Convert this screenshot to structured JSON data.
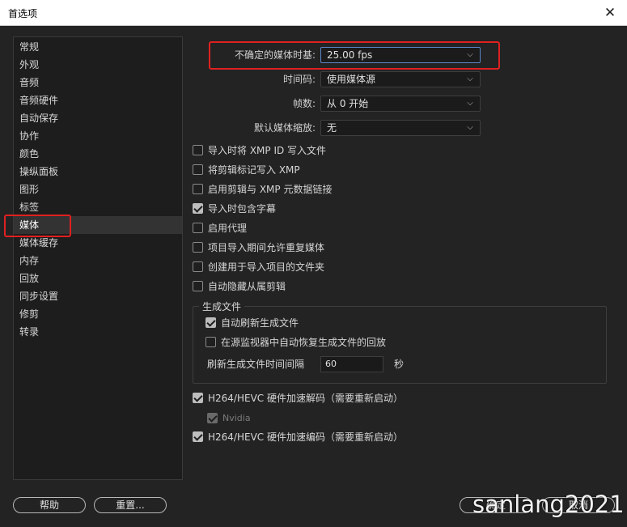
{
  "window": {
    "title": "首选项",
    "close_glyph": "✕"
  },
  "sidebar": {
    "items": [
      "常规",
      "外观",
      "音频",
      "音频硬件",
      "自动保存",
      "协作",
      "颜色",
      "操纵面板",
      "图形",
      "标签",
      "媒体",
      "媒体缓存",
      "内存",
      "回放",
      "同步设置",
      "修剪",
      "转录"
    ],
    "selected_index": 10
  },
  "media": {
    "fps": {
      "label": "不确定的媒体时基:",
      "value": "25.00 fps"
    },
    "timecode": {
      "label": "时间码:",
      "value": "使用媒体源"
    },
    "frame_number": {
      "label": "帧数:",
      "value": "从 0 开始"
    },
    "default_scaling": {
      "label": "默认媒体缩放:",
      "value": "无"
    },
    "checkboxes": [
      {
        "label": "导入时将 XMP ID 写入文件",
        "checked": false
      },
      {
        "label": "将剪辑标记写入 XMP",
        "checked": false
      },
      {
        "label": "启用剪辑与 XMP 元数据链接",
        "checked": false
      },
      {
        "label": "导入时包含字幕",
        "checked": true
      },
      {
        "label": "启用代理",
        "checked": false
      },
      {
        "label": "项目导入期间允许重复媒体",
        "checked": false
      },
      {
        "label": "创建用于导入项目的文件夹",
        "checked": false
      },
      {
        "label": "自动隐藏从属剪辑",
        "checked": false
      }
    ],
    "growing_files": {
      "title": "生成文件",
      "auto_refresh": {
        "label": "自动刷新生成文件",
        "checked": true
      },
      "auto_recover": {
        "label": "在源监视器中自动恢复生成文件的回放",
        "checked": false
      },
      "interval_label": "刷新生成文件时间间隔",
      "interval_value": "60",
      "interval_unit": "秒"
    },
    "hw_decode": {
      "label": "H264/HEVC 硬件加速解码（需要重新启动）",
      "checked": true
    },
    "nvidia": {
      "label": "Nvidia",
      "checked": true,
      "disabled": true
    },
    "hw_encode": {
      "label": "H264/HEVC 硬件加速编码（需要重新启动）",
      "checked": true
    }
  },
  "buttons": {
    "help": "帮助",
    "reset": "重置...",
    "ok": "确定",
    "cancel": "取消"
  },
  "watermark": "sanlang2021",
  "colors": {
    "highlight": "#e02020",
    "focus": "#5b86c9"
  },
  "icons": {
    "dropdown": "chevron-down-icon",
    "close": "close-icon"
  }
}
